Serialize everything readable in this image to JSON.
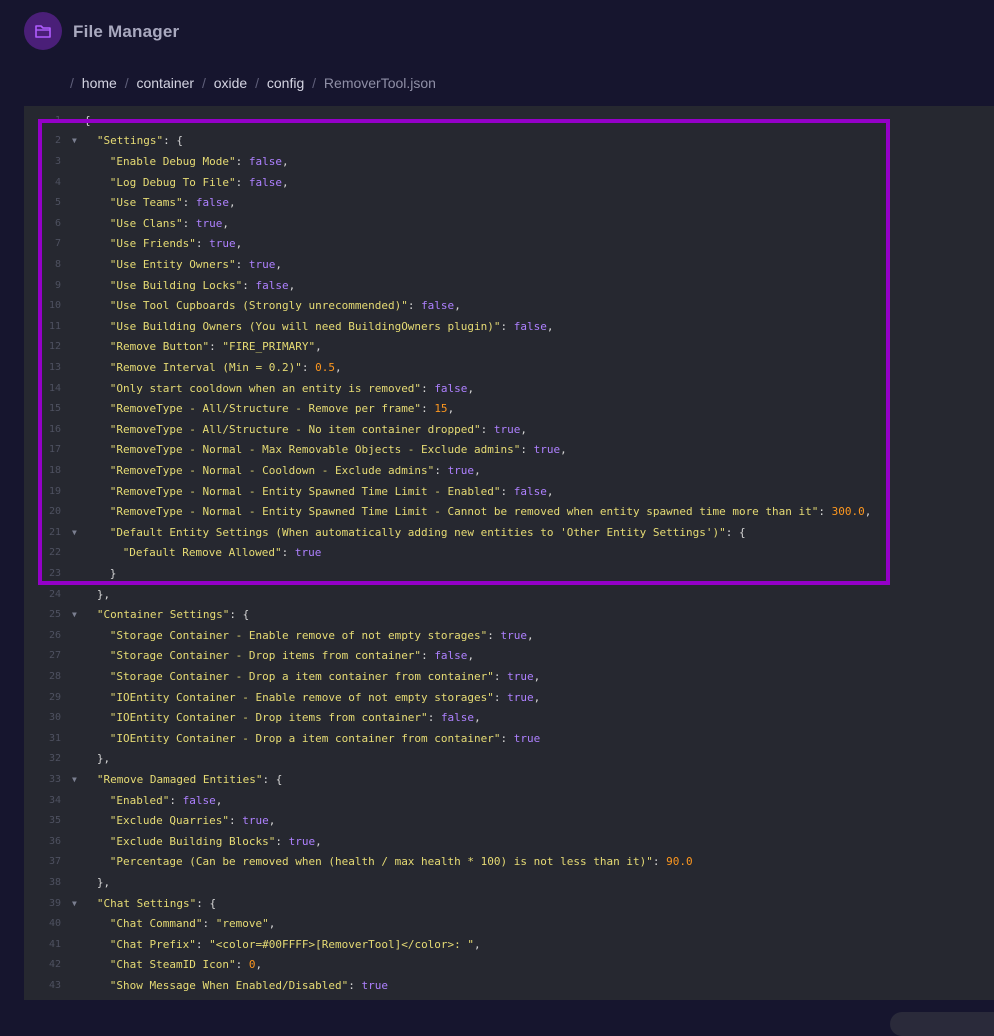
{
  "app": {
    "title": "File Manager",
    "icon": "folder-icon"
  },
  "breadcrumb": [
    "home",
    "container",
    "oxide",
    "config",
    "RemoverTool.json"
  ],
  "editor": {
    "lines": [
      {
        "num": "1",
        "fold": false,
        "indent": 0,
        "tokens": [
          {
            "t": "p",
            "v": "{"
          }
        ]
      },
      {
        "num": "2",
        "fold": true,
        "indent": 1,
        "tokens": [
          {
            "t": "k",
            "v": "\"Settings\""
          },
          {
            "t": "p",
            "v": ": {"
          }
        ]
      },
      {
        "num": "3",
        "fold": false,
        "indent": 2,
        "tokens": [
          {
            "t": "k",
            "v": "\"Enable Debug Mode\""
          },
          {
            "t": "p",
            "v": ": "
          },
          {
            "t": "b",
            "v": "false"
          },
          {
            "t": "p",
            "v": ","
          }
        ]
      },
      {
        "num": "4",
        "fold": false,
        "indent": 2,
        "tokens": [
          {
            "t": "k",
            "v": "\"Log Debug To File\""
          },
          {
            "t": "p",
            "v": ": "
          },
          {
            "t": "b",
            "v": "false"
          },
          {
            "t": "p",
            "v": ","
          }
        ]
      },
      {
        "num": "5",
        "fold": false,
        "indent": 2,
        "tokens": [
          {
            "t": "k",
            "v": "\"Use Teams\""
          },
          {
            "t": "p",
            "v": ": "
          },
          {
            "t": "b",
            "v": "false"
          },
          {
            "t": "p",
            "v": ","
          }
        ]
      },
      {
        "num": "6",
        "fold": false,
        "indent": 2,
        "tokens": [
          {
            "t": "k",
            "v": "\"Use Clans\""
          },
          {
            "t": "p",
            "v": ": "
          },
          {
            "t": "b",
            "v": "true"
          },
          {
            "t": "p",
            "v": ","
          }
        ]
      },
      {
        "num": "7",
        "fold": false,
        "indent": 2,
        "tokens": [
          {
            "t": "k",
            "v": "\"Use Friends\""
          },
          {
            "t": "p",
            "v": ": "
          },
          {
            "t": "b",
            "v": "true"
          },
          {
            "t": "p",
            "v": ","
          }
        ]
      },
      {
        "num": "8",
        "fold": false,
        "indent": 2,
        "tokens": [
          {
            "t": "k",
            "v": "\"Use Entity Owners\""
          },
          {
            "t": "p",
            "v": ": "
          },
          {
            "t": "b",
            "v": "true"
          },
          {
            "t": "p",
            "v": ","
          }
        ]
      },
      {
        "num": "9",
        "fold": false,
        "indent": 2,
        "tokens": [
          {
            "t": "k",
            "v": "\"Use Building Locks\""
          },
          {
            "t": "p",
            "v": ": "
          },
          {
            "t": "b",
            "v": "false"
          },
          {
            "t": "p",
            "v": ","
          }
        ]
      },
      {
        "num": "10",
        "fold": false,
        "indent": 2,
        "tokens": [
          {
            "t": "k",
            "v": "\"Use Tool Cupboards (Strongly unrecommended)\""
          },
          {
            "t": "p",
            "v": ": "
          },
          {
            "t": "b",
            "v": "false"
          },
          {
            "t": "p",
            "v": ","
          }
        ]
      },
      {
        "num": "11",
        "fold": false,
        "indent": 2,
        "tokens": [
          {
            "t": "k",
            "v": "\"Use Building Owners (You will need BuildingOwners plugin)\""
          },
          {
            "t": "p",
            "v": ": "
          },
          {
            "t": "b",
            "v": "false"
          },
          {
            "t": "p",
            "v": ","
          }
        ]
      },
      {
        "num": "12",
        "fold": false,
        "indent": 2,
        "tokens": [
          {
            "t": "k",
            "v": "\"Remove Button\""
          },
          {
            "t": "p",
            "v": ": "
          },
          {
            "t": "s",
            "v": "\"FIRE_PRIMARY\""
          },
          {
            "t": "p",
            "v": ","
          }
        ]
      },
      {
        "num": "13",
        "fold": false,
        "indent": 2,
        "tokens": [
          {
            "t": "k",
            "v": "\"Remove Interval (Min = 0.2)\""
          },
          {
            "t": "p",
            "v": ": "
          },
          {
            "t": "n",
            "v": "0.5"
          },
          {
            "t": "p",
            "v": ","
          }
        ]
      },
      {
        "num": "14",
        "fold": false,
        "indent": 2,
        "tokens": [
          {
            "t": "k",
            "v": "\"Only start cooldown when an entity is removed\""
          },
          {
            "t": "p",
            "v": ": "
          },
          {
            "t": "b",
            "v": "false"
          },
          {
            "t": "p",
            "v": ","
          }
        ]
      },
      {
        "num": "15",
        "fold": false,
        "indent": 2,
        "tokens": [
          {
            "t": "k",
            "v": "\"RemoveType - All/Structure - Remove per frame\""
          },
          {
            "t": "p",
            "v": ": "
          },
          {
            "t": "n",
            "v": "15"
          },
          {
            "t": "p",
            "v": ","
          }
        ]
      },
      {
        "num": "16",
        "fold": false,
        "indent": 2,
        "tokens": [
          {
            "t": "k",
            "v": "\"RemoveType - All/Structure - No item container dropped\""
          },
          {
            "t": "p",
            "v": ": "
          },
          {
            "t": "b",
            "v": "true"
          },
          {
            "t": "p",
            "v": ","
          }
        ]
      },
      {
        "num": "17",
        "fold": false,
        "indent": 2,
        "tokens": [
          {
            "t": "k",
            "v": "\"RemoveType - Normal - Max Removable Objects - Exclude admins\""
          },
          {
            "t": "p",
            "v": ": "
          },
          {
            "t": "b",
            "v": "true"
          },
          {
            "t": "p",
            "v": ","
          }
        ]
      },
      {
        "num": "18",
        "fold": false,
        "indent": 2,
        "tokens": [
          {
            "t": "k",
            "v": "\"RemoveType - Normal - Cooldown - Exclude admins\""
          },
          {
            "t": "p",
            "v": ": "
          },
          {
            "t": "b",
            "v": "true"
          },
          {
            "t": "p",
            "v": ","
          }
        ]
      },
      {
        "num": "19",
        "fold": false,
        "indent": 2,
        "tokens": [
          {
            "t": "k",
            "v": "\"RemoveType - Normal - Entity Spawned Time Limit - Enabled\""
          },
          {
            "t": "p",
            "v": ": "
          },
          {
            "t": "b",
            "v": "false"
          },
          {
            "t": "p",
            "v": ","
          }
        ]
      },
      {
        "num": "20",
        "fold": false,
        "indent": 2,
        "tokens": [
          {
            "t": "k",
            "v": "\"RemoveType - Normal - Entity Spawned Time Limit - Cannot be removed when entity spawned time more than it\""
          },
          {
            "t": "p",
            "v": ": "
          },
          {
            "t": "n",
            "v": "300.0"
          },
          {
            "t": "p",
            "v": ","
          }
        ]
      },
      {
        "num": "21",
        "fold": true,
        "indent": 2,
        "tokens": [
          {
            "t": "k",
            "v": "\"Default Entity Settings (When automatically adding new entities to 'Other Entity Settings')\""
          },
          {
            "t": "p",
            "v": ": {"
          }
        ]
      },
      {
        "num": "22",
        "fold": false,
        "indent": 3,
        "tokens": [
          {
            "t": "k",
            "v": "\"Default Remove Allowed\""
          },
          {
            "t": "p",
            "v": ": "
          },
          {
            "t": "b",
            "v": "true"
          }
        ]
      },
      {
        "num": "23",
        "fold": false,
        "indent": 2,
        "tokens": [
          {
            "t": "p",
            "v": "}"
          }
        ]
      },
      {
        "num": "24",
        "fold": false,
        "indent": 1,
        "tokens": [
          {
            "t": "p",
            "v": "},"
          }
        ]
      },
      {
        "num": "25",
        "fold": true,
        "indent": 1,
        "tokens": [
          {
            "t": "k",
            "v": "\"Container Settings\""
          },
          {
            "t": "p",
            "v": ": {"
          }
        ]
      },
      {
        "num": "26",
        "fold": false,
        "indent": 2,
        "tokens": [
          {
            "t": "k",
            "v": "\"Storage Container - Enable remove of not empty storages\""
          },
          {
            "t": "p",
            "v": ": "
          },
          {
            "t": "b",
            "v": "true"
          },
          {
            "t": "p",
            "v": ","
          }
        ]
      },
      {
        "num": "27",
        "fold": false,
        "indent": 2,
        "tokens": [
          {
            "t": "k",
            "v": "\"Storage Container - Drop items from container\""
          },
          {
            "t": "p",
            "v": ": "
          },
          {
            "t": "b",
            "v": "false"
          },
          {
            "t": "p",
            "v": ","
          }
        ]
      },
      {
        "num": "28",
        "fold": false,
        "indent": 2,
        "tokens": [
          {
            "t": "k",
            "v": "\"Storage Container - Drop a item container from container\""
          },
          {
            "t": "p",
            "v": ": "
          },
          {
            "t": "b",
            "v": "true"
          },
          {
            "t": "p",
            "v": ","
          }
        ]
      },
      {
        "num": "29",
        "fold": false,
        "indent": 2,
        "tokens": [
          {
            "t": "k",
            "v": "\"IOEntity Container - Enable remove of not empty storages\""
          },
          {
            "t": "p",
            "v": ": "
          },
          {
            "t": "b",
            "v": "true"
          },
          {
            "t": "p",
            "v": ","
          }
        ]
      },
      {
        "num": "30",
        "fold": false,
        "indent": 2,
        "tokens": [
          {
            "t": "k",
            "v": "\"IOEntity Container - Drop items from container\""
          },
          {
            "t": "p",
            "v": ": "
          },
          {
            "t": "b",
            "v": "false"
          },
          {
            "t": "p",
            "v": ","
          }
        ]
      },
      {
        "num": "31",
        "fold": false,
        "indent": 2,
        "tokens": [
          {
            "t": "k",
            "v": "\"IOEntity Container - Drop a item container from container\""
          },
          {
            "t": "p",
            "v": ": "
          },
          {
            "t": "b",
            "v": "true"
          }
        ]
      },
      {
        "num": "32",
        "fold": false,
        "indent": 1,
        "tokens": [
          {
            "t": "p",
            "v": "},"
          }
        ]
      },
      {
        "num": "33",
        "fold": true,
        "indent": 1,
        "tokens": [
          {
            "t": "k",
            "v": "\"Remove Damaged Entities\""
          },
          {
            "t": "p",
            "v": ": {"
          }
        ]
      },
      {
        "num": "34",
        "fold": false,
        "indent": 2,
        "tokens": [
          {
            "t": "k",
            "v": "\"Enabled\""
          },
          {
            "t": "p",
            "v": ": "
          },
          {
            "t": "b",
            "v": "false"
          },
          {
            "t": "p",
            "v": ","
          }
        ]
      },
      {
        "num": "35",
        "fold": false,
        "indent": 2,
        "tokens": [
          {
            "t": "k",
            "v": "\"Exclude Quarries\""
          },
          {
            "t": "p",
            "v": ": "
          },
          {
            "t": "b",
            "v": "true"
          },
          {
            "t": "p",
            "v": ","
          }
        ]
      },
      {
        "num": "36",
        "fold": false,
        "indent": 2,
        "tokens": [
          {
            "t": "k",
            "v": "\"Exclude Building Blocks\""
          },
          {
            "t": "p",
            "v": ": "
          },
          {
            "t": "b",
            "v": "true"
          },
          {
            "t": "p",
            "v": ","
          }
        ]
      },
      {
        "num": "37",
        "fold": false,
        "indent": 2,
        "tokens": [
          {
            "t": "k",
            "v": "\"Percentage (Can be removed when (health / max health * 100) is not less than it)\""
          },
          {
            "t": "p",
            "v": ": "
          },
          {
            "t": "n",
            "v": "90.0"
          }
        ]
      },
      {
        "num": "38",
        "fold": false,
        "indent": 1,
        "tokens": [
          {
            "t": "p",
            "v": "},"
          }
        ]
      },
      {
        "num": "39",
        "fold": true,
        "indent": 1,
        "tokens": [
          {
            "t": "k",
            "v": "\"Chat Settings\""
          },
          {
            "t": "p",
            "v": ": {"
          }
        ]
      },
      {
        "num": "40",
        "fold": false,
        "indent": 2,
        "tokens": [
          {
            "t": "k",
            "v": "\"Chat Command\""
          },
          {
            "t": "p",
            "v": ": "
          },
          {
            "t": "s",
            "v": "\"remove\""
          },
          {
            "t": "p",
            "v": ","
          }
        ]
      },
      {
        "num": "41",
        "fold": false,
        "indent": 2,
        "tokens": [
          {
            "t": "k",
            "v": "\"Chat Prefix\""
          },
          {
            "t": "p",
            "v": ": "
          },
          {
            "t": "s",
            "v": "\"<color=#00FFFF>[RemoverTool]</color>: \""
          },
          {
            "t": "p",
            "v": ","
          }
        ]
      },
      {
        "num": "42",
        "fold": false,
        "indent": 2,
        "tokens": [
          {
            "t": "k",
            "v": "\"Chat SteamID Icon\""
          },
          {
            "t": "p",
            "v": ": "
          },
          {
            "t": "n",
            "v": "0"
          },
          {
            "t": "p",
            "v": ","
          }
        ]
      },
      {
        "num": "43",
        "fold": false,
        "indent": 2,
        "tokens": [
          {
            "t": "k",
            "v": "\"Show Message When Enabled/Disabled\""
          },
          {
            "t": "p",
            "v": ": "
          },
          {
            "t": "b",
            "v": "true"
          }
        ]
      }
    ]
  }
}
